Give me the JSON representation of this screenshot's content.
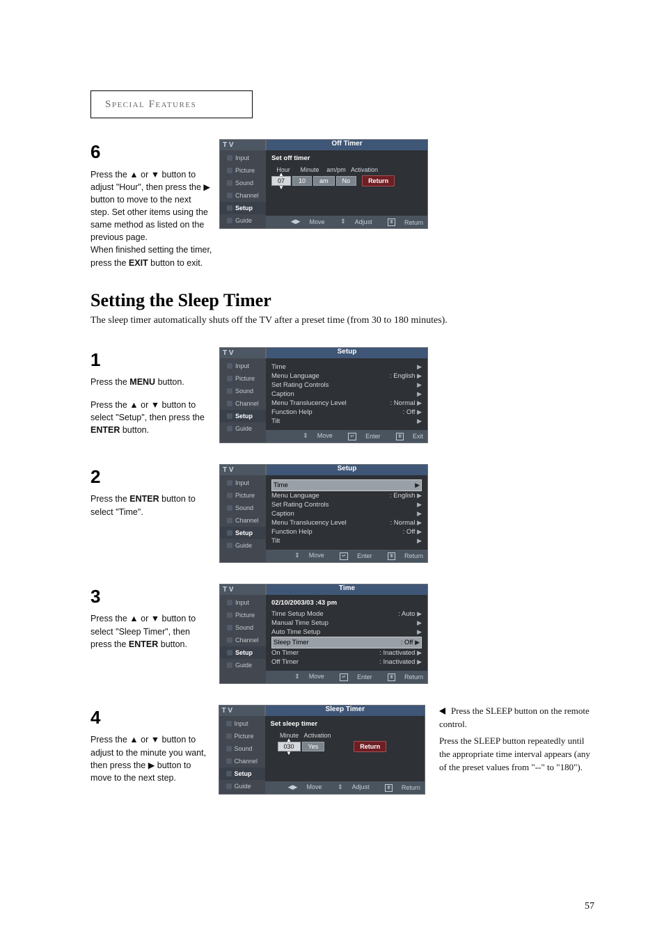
{
  "header": "Special Features",
  "page_number": "57",
  "step6": {
    "num": "6",
    "text_a": "Press the ▲ or ▼ button to adjust \"Hour\", then press the ▶ button to move to the next step. Set other items using the same method as listed on the previous page.",
    "text_b": "When finished setting the timer, press the ",
    "text_b_bold": "EXIT",
    "text_b_end": " button to exit."
  },
  "osd6": {
    "tv": "T V",
    "title": "Off Timer",
    "menu": [
      "Input",
      "Picture",
      "Sound",
      "Channel",
      "Setup",
      "Guide"
    ],
    "subhead": "Set off timer",
    "labels": [
      "Hour",
      "Minute",
      "am/pm",
      "Activation"
    ],
    "fields": [
      "07",
      "10",
      "am",
      "No"
    ],
    "return": "Return",
    "foot": {
      "move": "Move",
      "adjust": "Adjust",
      "return": "Return"
    }
  },
  "section": {
    "title": "Setting the Sleep Timer",
    "sub": "The sleep timer automatically shuts off the TV after a preset time (from 30 to 180 minutes)."
  },
  "step1": {
    "num": "1",
    "a": "Press the ",
    "a_bold": "MENU",
    "a_end": " button.",
    "b": "Press the ▲ or ▼ button to select \"Setup\", then press the ",
    "b_bold": "ENTER",
    "b_end": " button."
  },
  "osd12": {
    "title": "Setup",
    "items": [
      {
        "l": "Time",
        "r": "",
        "arrow": true
      },
      {
        "l": "Menu Language",
        "r": ": English",
        "arrow": true
      },
      {
        "l": "Set Rating Controls",
        "r": "",
        "arrow": true
      },
      {
        "l": "Caption",
        "r": "",
        "arrow": true
      },
      {
        "l": "Menu Translucency Level",
        "r": ": Normal",
        "arrow": true
      },
      {
        "l": "Function Help",
        "r": ": Off",
        "arrow": true
      },
      {
        "l": "Tilt",
        "r": "",
        "arrow": true
      }
    ],
    "foot1": {
      "move": "Move",
      "enter": "Enter",
      "exit": "Exit"
    },
    "foot2": {
      "move": "Move",
      "enter": "Enter",
      "return": "Return"
    }
  },
  "step2": {
    "num": "2",
    "a": "Press the ",
    "a_bold": "ENTER",
    "a_end": " button to select \"Time\"."
  },
  "step3": {
    "num": "3",
    "a": "Press the ▲ or ▼ button to select \"Sleep Timer\", then press the ",
    "a_bold": "ENTER",
    "a_end": " button."
  },
  "osd3": {
    "title": "Time",
    "header": "02/10/2003/03 :43 pm",
    "items": [
      {
        "l": "Time Setup Mode",
        "r": ": Auto",
        "arrow": true,
        "hl": false
      },
      {
        "l": "Manual Time Setup",
        "r": "",
        "arrow": true,
        "hl": false
      },
      {
        "l": "Auto Time Setup",
        "r": "",
        "arrow": true,
        "hl": false
      },
      {
        "l": "Sleep Timer",
        "r": ": Off",
        "arrow": true,
        "hl": true
      },
      {
        "l": "On Timer",
        "r": ": Inactivated",
        "arrow": true,
        "hl": false
      },
      {
        "l": "Off Timer",
        "r": ": Inactivated",
        "arrow": true,
        "hl": false
      }
    ],
    "foot": {
      "move": "Move",
      "enter": "Enter",
      "return": "Return"
    }
  },
  "step4": {
    "num": "4",
    "text": "Press the ▲ or ▼ button to adjust to the minute you want, then press the ▶ button to move to the next step."
  },
  "osd4": {
    "title": "Sleep Timer",
    "subhead": "Set sleep timer",
    "labels": [
      "Minute",
      "Activation"
    ],
    "fields": [
      "030",
      "Yes"
    ],
    "return": "Return",
    "foot": {
      "move": "Move",
      "adjust": "Adjust",
      "return": "Return"
    }
  },
  "sidenote": {
    "a": "Press the SLEEP button on the remote control.",
    "b": "Press the SLEEP button repeatedly until the appropriate time interval appears (any of the preset values from \"--\" to \"180\")."
  }
}
